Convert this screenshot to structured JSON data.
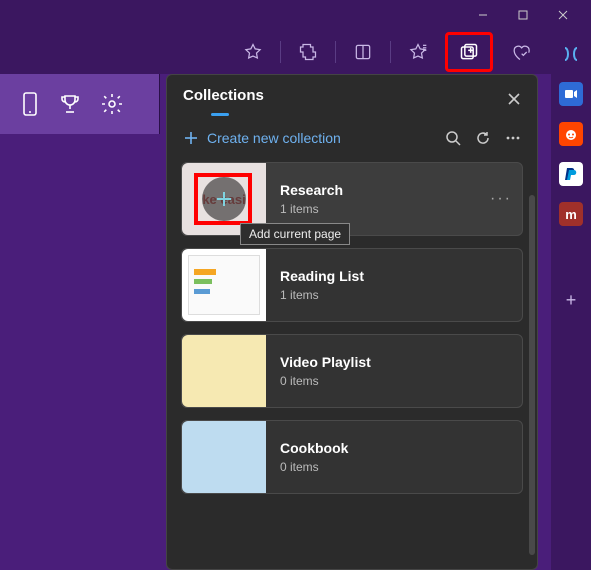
{
  "window": {
    "minimize": "minimize",
    "maximize": "maximize",
    "close": "close"
  },
  "toolbar": {
    "favorite": "favorite",
    "extensions": "extensions",
    "book": "reading-list",
    "favorites_star": "favorites",
    "collections": "collections",
    "browser_essentials": "browser-essentials",
    "more": "more"
  },
  "left_icons": {
    "mobile": "mobile",
    "trophy": "rewards",
    "settings": "settings"
  },
  "right_sidebar": {
    "copilot": "copilot",
    "zoom": "zoom",
    "reddit": "reddit",
    "paypal": "paypal",
    "m": "m",
    "add": "+"
  },
  "panel": {
    "title": "Collections",
    "create": "Create new collection",
    "tooltip": "Add current page"
  },
  "collections": [
    {
      "name": "Research",
      "count_label": "1 items",
      "thumb_text": "ke    easi"
    },
    {
      "name": "Reading List",
      "count_label": "1 items"
    },
    {
      "name": "Video Playlist",
      "count_label": "0 items"
    },
    {
      "name": "Cookbook",
      "count_label": "0 items"
    }
  ]
}
